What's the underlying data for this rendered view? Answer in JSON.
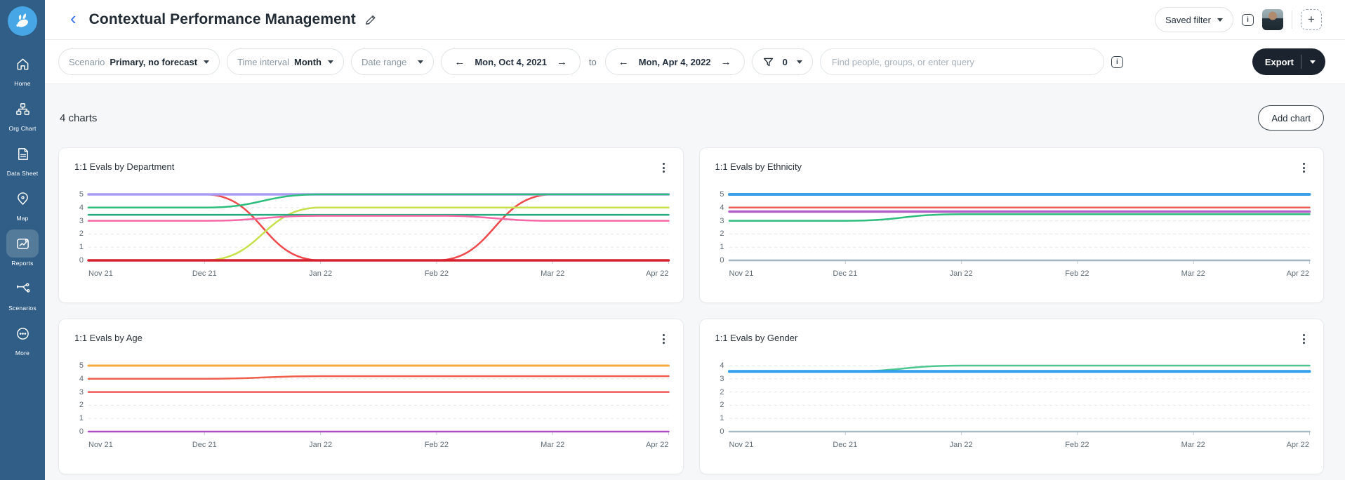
{
  "app": {
    "name": "charthop",
    "logo_color": "#47a7e6",
    "sidebar_bg": "#305e86",
    "export_bg": "#1b232e"
  },
  "sidebar": {
    "items": [
      {
        "label": "Home",
        "active": false
      },
      {
        "label": "Org Chart",
        "active": false
      },
      {
        "label": "Data Sheet",
        "active": false
      },
      {
        "label": "Map",
        "active": false
      },
      {
        "label": "Reports",
        "active": true
      },
      {
        "label": "Scenarios",
        "active": false
      },
      {
        "label": "More",
        "active": false
      }
    ]
  },
  "header": {
    "back": "‹",
    "title": "Contextual Performance Management",
    "saved_filter_label": "Saved filter",
    "info": "i",
    "add_plus": "+"
  },
  "filter_bar": {
    "scenario_label": "Scenario",
    "scenario_value": "Primary, no forecast",
    "time_interval_label": "Time interval",
    "time_interval_value": "Month",
    "date_range_label": "Date range",
    "date_from": "Mon, Oct 4, 2021",
    "to_label": "to",
    "date_to": "Mon, Apr 4, 2022",
    "arrow_left": "←",
    "arrow_right": "→",
    "filter_count": "0",
    "search_placeholder": "Find people, groups, or enter query",
    "info": "i",
    "export_label": "Export"
  },
  "content": {
    "count_label": "4 charts",
    "add_chart_label": "Add chart"
  },
  "chart_data": [
    {
      "type": "line",
      "title": "1:1 Evals by Department",
      "x_labels": [
        "Nov 21",
        "Dec 21",
        "Jan 22",
        "Feb 22",
        "Mar 22",
        "Apr 22"
      ],
      "y_ticks": [
        "5",
        "4",
        "3",
        "2",
        "1",
        "0"
      ],
      "ymax": 5,
      "grid": "dashed-horizontal",
      "legend": "none",
      "series": [
        {
          "name": "salmon-red-line",
          "color": "#ef4a4e",
          "width": 2.5,
          "values": [
            5,
            5,
            0,
            0,
            5,
            5
          ]
        },
        {
          "name": "purple-line",
          "color": "#a79bf2",
          "width": 3.5,
          "values": [
            5,
            5,
            5,
            5,
            5,
            5
          ]
        },
        {
          "name": "chartreuse-line",
          "color": "#c6e14b",
          "width": 2.5,
          "values": [
            0,
            0,
            4,
            4,
            4,
            4
          ]
        },
        {
          "name": "green-line",
          "color": "#2dbe7d",
          "width": 2.5,
          "values": [
            4,
            4,
            5,
            5,
            5,
            5
          ]
        },
        {
          "name": "teal-green-line",
          "color": "#27ab80",
          "width": 2.5,
          "values": [
            3.45,
            3.45,
            3.45,
            3.45,
            3.45,
            3.45
          ]
        },
        {
          "name": "pink-line",
          "color": "#f667a5",
          "width": 2.5,
          "values": [
            3,
            3,
            3.38,
            3.38,
            3,
            3
          ]
        },
        {
          "name": "crimson-line",
          "color": "#d6202f",
          "width": 3.5,
          "values": [
            0,
            0,
            0,
            0,
            0,
            0
          ]
        }
      ]
    },
    {
      "type": "line",
      "title": "1:1 Evals by Ethnicity",
      "x_labels": [
        "Nov 21",
        "Dec 21",
        "Jan 22",
        "Feb 22",
        "Mar 22",
        "Apr 22"
      ],
      "y_ticks": [
        "5",
        "4",
        "3",
        "2",
        "1",
        "0"
      ],
      "ymax": 5,
      "grid": "dashed-horizontal",
      "legend": "none",
      "series": [
        {
          "name": "pink-zero-line",
          "color": "#eba6bb",
          "width": 2,
          "values": [
            0,
            0,
            0,
            0,
            0,
            0
          ]
        },
        {
          "name": "gray-zero-line",
          "color": "#a4b6c2",
          "width": 2.5,
          "values": [
            0,
            0,
            0,
            0,
            0,
            0
          ]
        },
        {
          "name": "green-line",
          "color": "#2dbe7d",
          "width": 2.5,
          "values": [
            3,
            3,
            3.5,
            3.5,
            3.5,
            3.5
          ]
        },
        {
          "name": "purple-line",
          "color": "#b35fc8",
          "width": 3.5,
          "values": [
            3.7,
            3.7,
            3.7,
            3.7,
            3.7,
            3.7
          ]
        },
        {
          "name": "red-line",
          "color": "#ee5a56",
          "width": 2.5,
          "values": [
            4,
            4,
            4,
            4,
            4,
            4
          ]
        },
        {
          "name": "blue-line",
          "color": "#3f9ee8",
          "width": 4,
          "values": [
            5,
            5,
            5,
            5,
            5,
            5
          ]
        }
      ]
    },
    {
      "type": "line",
      "title": "1:1 Evals by Age",
      "x_labels": [
        "Nov 21",
        "Dec 21",
        "Jan 22",
        "Feb 22",
        "Mar 22",
        "Apr 22"
      ],
      "y_ticks": [
        "5",
        "4",
        "3",
        "2",
        "1",
        "0"
      ],
      "ymax": 5,
      "grid": "dashed-horizontal",
      "legend": "none",
      "series": [
        {
          "name": "violet-line",
          "color": "#ad4cc2",
          "width": 2.5,
          "values": [
            0,
            0,
            0,
            0,
            0,
            0
          ]
        },
        {
          "name": "red-line",
          "color": "#ee5a5a",
          "width": 2.5,
          "values": [
            3,
            3,
            3,
            3,
            3,
            3
          ]
        },
        {
          "name": "red-orange-line",
          "color": "#ef5f4b",
          "width": 2.5,
          "values": [
            4,
            4,
            4.2,
            4.2,
            4.2,
            4.2
          ]
        },
        {
          "name": "orange-line",
          "color": "#f6a93e",
          "width": 3,
          "values": [
            5,
            5,
            5,
            5,
            5,
            5
          ]
        }
      ]
    },
    {
      "type": "line",
      "title": "1:1 Evals by Gender",
      "x_labels": [
        "Nov 21",
        "Dec 21",
        "Jan 22",
        "Feb 22",
        "Mar 22",
        "Apr 22"
      ],
      "y_ticks": [
        "4",
        "3",
        "2",
        "2",
        "1",
        "0"
      ],
      "ymax": 4,
      "grid": "dashed-horizontal",
      "legend": "none",
      "series": [
        {
          "name": "tan-zero-line",
          "color": "#c0b6a6",
          "width": 2,
          "values": [
            0,
            0,
            0,
            0,
            0,
            0
          ]
        },
        {
          "name": "gray-zero-line",
          "color": "#a9bbc6",
          "width": 2.5,
          "values": [
            0,
            0,
            0,
            0,
            0,
            0
          ]
        },
        {
          "name": "green-line",
          "color": "#4cc78f",
          "width": 2.5,
          "values": [
            3.65,
            3.65,
            4,
            4,
            4,
            4
          ]
        },
        {
          "name": "blue-line",
          "color": "#2f9ded",
          "width": 4,
          "values": [
            3.65,
            3.65,
            3.65,
            3.65,
            3.65,
            3.65
          ]
        }
      ]
    }
  ]
}
